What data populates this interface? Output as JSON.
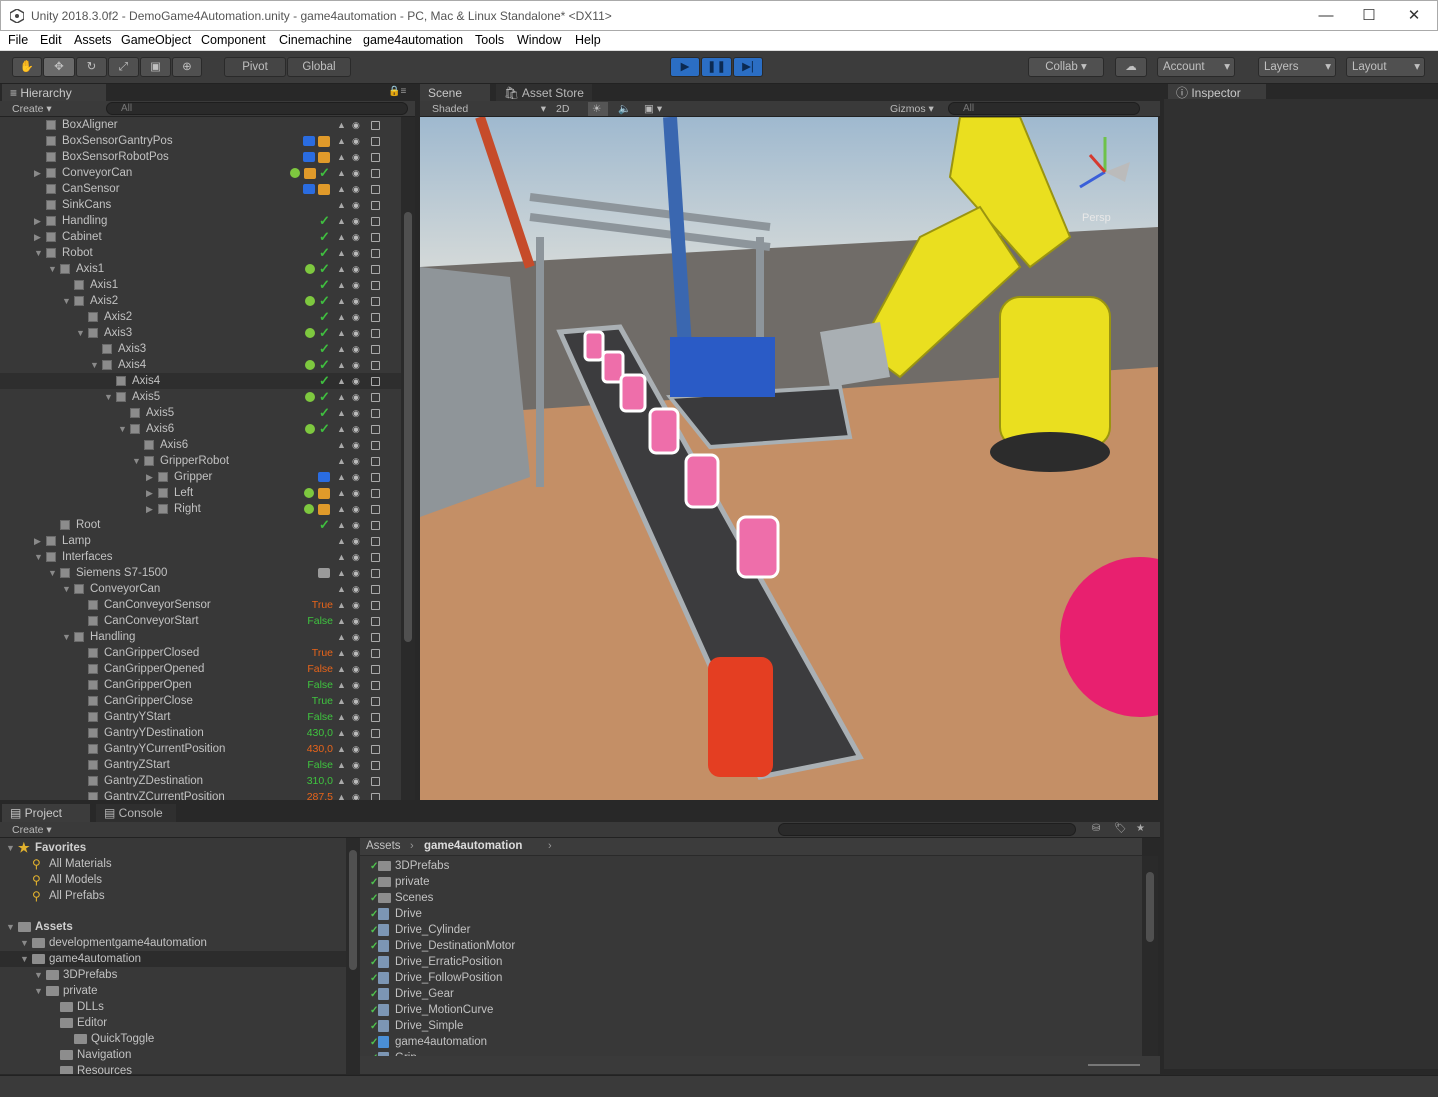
{
  "window": {
    "title": "Unity 2018.3.0f2 - DemoGame4Automation.unity - game4automation - PC, Mac & Linux Standalone* <DX11>",
    "min": "—",
    "max": "☐",
    "close": "✕"
  },
  "menu": [
    "File",
    "Edit",
    "Assets",
    "GameObject",
    "Component",
    "Cinemachine",
    "game4automation",
    "Tools",
    "Window",
    "Help"
  ],
  "toolbar": {
    "pivot": "Pivot",
    "global": "Global",
    "collab": "Collab",
    "account": "Account",
    "layers": "Layers",
    "layout": "Layout"
  },
  "hierarchy": {
    "tab": "Hierarchy",
    "create": "Create",
    "search_placeholder": "All",
    "rows": [
      {
        "label": "BoxAligner",
        "depth": 1,
        "arrow": "",
        "icons": []
      },
      {
        "label": "BoxSensorGantryPos",
        "depth": 1,
        "arrow": "",
        "icons": [
          "blue",
          "orange"
        ]
      },
      {
        "label": "BoxSensorRobotPos",
        "depth": 1,
        "arrow": "",
        "icons": [
          "blue",
          "orange"
        ]
      },
      {
        "label": "ConveyorCan",
        "depth": 1,
        "arrow": "▶",
        "icons": [
          "gear",
          "orange",
          "check"
        ]
      },
      {
        "label": "CanSensor",
        "depth": 1,
        "arrow": "",
        "icons": [
          "blue",
          "orange"
        ]
      },
      {
        "label": "SinkCans",
        "depth": 1,
        "arrow": "",
        "icons": []
      },
      {
        "label": "Handling",
        "depth": 1,
        "arrow": "▶",
        "icons": [
          "check"
        ]
      },
      {
        "label": "Cabinet",
        "depth": 1,
        "arrow": "▶",
        "icons": [
          "check"
        ]
      },
      {
        "label": "Robot",
        "depth": 1,
        "arrow": "▼",
        "icons": [
          "check"
        ]
      },
      {
        "label": "Axis1",
        "depth": 2,
        "arrow": "▼",
        "icons": [
          "gear",
          "check"
        ]
      },
      {
        "label": "Axis1",
        "depth": 3,
        "arrow": "",
        "icons": [
          "check"
        ]
      },
      {
        "label": "Axis2",
        "depth": 3,
        "arrow": "▼",
        "icons": [
          "gear",
          "check"
        ]
      },
      {
        "label": "Axis2",
        "depth": 4,
        "arrow": "",
        "icons": [
          "check"
        ]
      },
      {
        "label": "Axis3",
        "depth": 4,
        "arrow": "▼",
        "icons": [
          "gear",
          "check"
        ]
      },
      {
        "label": "Axis3",
        "depth": 5,
        "arrow": "",
        "icons": [
          "check"
        ]
      },
      {
        "label": "Axis4",
        "depth": 5,
        "arrow": "▼",
        "icons": [
          "gear",
          "check"
        ]
      },
      {
        "label": "Axis4",
        "depth": 6,
        "arrow": "",
        "icons": [
          "check"
        ],
        "selected": true
      },
      {
        "label": "Axis5",
        "depth": 6,
        "arrow": "▼",
        "icons": [
          "gear",
          "check"
        ]
      },
      {
        "label": "Axis5",
        "depth": 7,
        "arrow": "",
        "icons": [
          "check"
        ]
      },
      {
        "label": "Axis6",
        "depth": 7,
        "arrow": "▼",
        "icons": [
          "gear",
          "check"
        ]
      },
      {
        "label": "Axis6",
        "depth": 8,
        "arrow": "",
        "icons": []
      },
      {
        "label": "GripperRobot",
        "depth": 8,
        "arrow": "▼",
        "icons": []
      },
      {
        "label": "Gripper",
        "depth": 9,
        "arrow": "▶",
        "icons": [
          "blue"
        ]
      },
      {
        "label": "Left",
        "depth": 9,
        "arrow": "▶",
        "icons": [
          "gear",
          "orange"
        ]
      },
      {
        "label": "Right",
        "depth": 9,
        "arrow": "▶",
        "icons": [
          "gear",
          "orange"
        ]
      },
      {
        "label": "Root",
        "depth": 2,
        "arrow": "",
        "icons": [
          "check"
        ]
      },
      {
        "label": "Lamp",
        "depth": 1,
        "arrow": "▶",
        "icons": []
      },
      {
        "label": "Interfaces",
        "depth": 1,
        "arrow": "▼",
        "icons": []
      },
      {
        "label": "Siemens S7-1500",
        "depth": 2,
        "arrow": "▼",
        "icons": [
          "gray"
        ]
      },
      {
        "label": "ConveyorCan",
        "depth": 3,
        "arrow": "▼",
        "icons": []
      },
      {
        "label": "CanConveyorSensor",
        "depth": 4,
        "arrow": "",
        "icons": [],
        "value": "True",
        "vcolor": "orange"
      },
      {
        "label": "CanConveyorStart",
        "depth": 4,
        "arrow": "",
        "icons": [],
        "value": "False",
        "vcolor": "green"
      },
      {
        "label": "Handling",
        "depth": 3,
        "arrow": "▼",
        "icons": []
      },
      {
        "label": "CanGripperClosed",
        "depth": 4,
        "arrow": "",
        "icons": [],
        "value": "True",
        "vcolor": "orange"
      },
      {
        "label": "CanGripperOpened",
        "depth": 4,
        "arrow": "",
        "icons": [],
        "value": "False",
        "vcolor": "orange"
      },
      {
        "label": "CanGripperOpen",
        "depth": 4,
        "arrow": "",
        "icons": [],
        "value": "False",
        "vcolor": "green"
      },
      {
        "label": "CanGripperClose",
        "depth": 4,
        "arrow": "",
        "icons": [],
        "value": "True",
        "vcolor": "green"
      },
      {
        "label": "GantryYStart",
        "depth": 4,
        "arrow": "",
        "icons": [],
        "value": "False",
        "vcolor": "green"
      },
      {
        "label": "GantryYDestination",
        "depth": 4,
        "arrow": "",
        "icons": [],
        "value": "430,0",
        "vcolor": "green"
      },
      {
        "label": "GantryYCurrentPosition",
        "depth": 4,
        "arrow": "",
        "icons": [],
        "value": "430,0",
        "vcolor": "orange"
      },
      {
        "label": "GantryZStart",
        "depth": 4,
        "arrow": "",
        "icons": [],
        "value": "False",
        "vcolor": "green"
      },
      {
        "label": "GantryZDestination",
        "depth": 4,
        "arrow": "",
        "icons": [],
        "value": "310,0",
        "vcolor": "green"
      },
      {
        "label": "GantryZCurrentPosition",
        "depth": 4,
        "arrow": "",
        "icons": [],
        "value": "287,5",
        "vcolor": "orange"
      }
    ]
  },
  "scene": {
    "tab_scene": "Scene",
    "tab_store": "Asset Store",
    "shading": "Shaded",
    "mode2d": "2D",
    "gizmos": "Gizmos",
    "search_placeholder": "All",
    "persp": "Persp"
  },
  "inspector": {
    "tab": "Inspector"
  },
  "project": {
    "tab_project": "Project",
    "tab_console": "Console",
    "create": "Create",
    "tree": [
      {
        "label": "Favorites",
        "kind": "star",
        "depth": 0,
        "bold": true
      },
      {
        "label": "All Materials",
        "kind": "search",
        "depth": 1
      },
      {
        "label": "All Models",
        "kind": "search",
        "depth": 1
      },
      {
        "label": "All Prefabs",
        "kind": "search",
        "depth": 1
      },
      {
        "label": "",
        "kind": "spacer",
        "depth": 0
      },
      {
        "label": "Assets",
        "kind": "folder",
        "depth": 0,
        "bold": true
      },
      {
        "label": "developmentgame4automation",
        "kind": "folder",
        "depth": 1
      },
      {
        "label": "game4automation",
        "kind": "folder",
        "depth": 1,
        "selected": true
      },
      {
        "label": "3DPrefabs",
        "kind": "folder",
        "depth": 2
      },
      {
        "label": "private",
        "kind": "folder",
        "depth": 2
      },
      {
        "label": "DLLs",
        "kind": "folder",
        "depth": 3
      },
      {
        "label": "Editor",
        "kind": "folder",
        "depth": 3
      },
      {
        "label": "QuickToggle",
        "kind": "folder",
        "depth": 4
      },
      {
        "label": "Navigation",
        "kind": "folder",
        "depth": 3
      },
      {
        "label": "Resources",
        "kind": "folder",
        "depth": 3
      }
    ],
    "breadcrumb": [
      "Assets",
      "game4automation"
    ],
    "files": [
      {
        "label": "3DPrefabs",
        "kind": "folder"
      },
      {
        "label": "private",
        "kind": "folder"
      },
      {
        "label": "Scenes",
        "kind": "folder"
      },
      {
        "label": "Drive",
        "kind": "script"
      },
      {
        "label": "Drive_Cylinder",
        "kind": "script"
      },
      {
        "label": "Drive_DestinationMotor",
        "kind": "script"
      },
      {
        "label": "Drive_ErraticPosition",
        "kind": "script"
      },
      {
        "label": "Drive_FollowPosition",
        "kind": "script"
      },
      {
        "label": "Drive_Gear",
        "kind": "script"
      },
      {
        "label": "Drive_MotionCurve",
        "kind": "script"
      },
      {
        "label": "Drive_Simple",
        "kind": "script"
      },
      {
        "label": "game4automation",
        "kind": "prefab"
      },
      {
        "label": "Grip",
        "kind": "script"
      }
    ]
  }
}
